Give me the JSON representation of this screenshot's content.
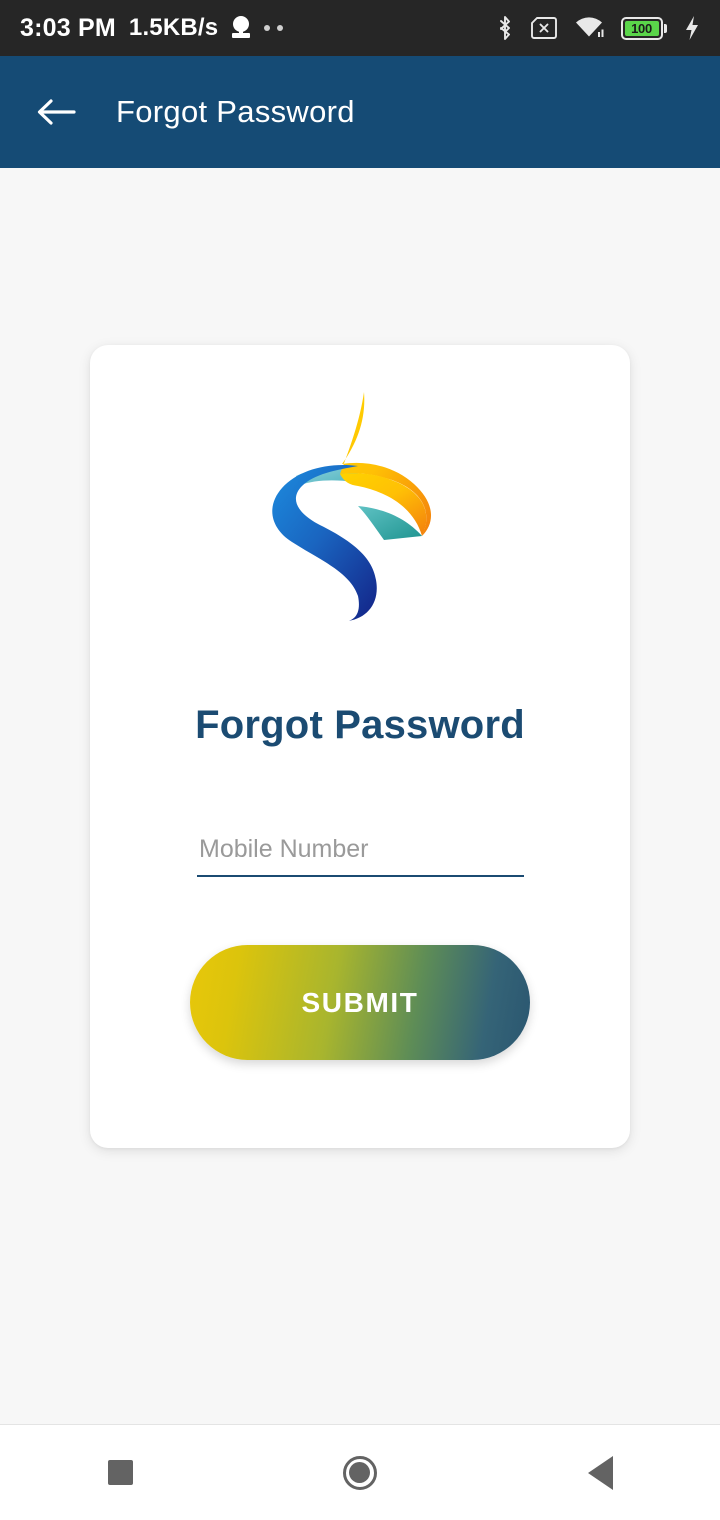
{
  "status_bar": {
    "time": "3:03 PM",
    "network_speed": "1.5KB/s",
    "battery_percent": "100",
    "icons": {
      "mic": "microphone-icon",
      "dots": "more-dots-icon",
      "bluetooth": "bluetooth-icon",
      "sd_card": "sd-card-error-icon",
      "wifi": "wifi-icon",
      "battery": "battery-icon",
      "charging": "charging-bolt-icon"
    },
    "colors": {
      "background": "#262626",
      "battery_fill": "#5ad54a",
      "text": "#ffffff"
    }
  },
  "app_bar": {
    "back_icon": "back-arrow-icon",
    "title": "Forgot Password",
    "color": "#154B75"
  },
  "card": {
    "logo": {
      "name": "company-logo",
      "colors": {
        "yellow": "#FFC805",
        "orange": "#F58B0A",
        "teal": "#2FA5A0",
        "light_teal": "#6FC6D0",
        "blue_light": "#1E7FD4",
        "blue_dark": "#152D90"
      }
    },
    "title": "Forgot Password",
    "title_color": "#1B4B72",
    "mobile_field": {
      "placeholder": "Mobile Number",
      "value": "",
      "underline_color": "#1B4B72"
    },
    "submit_button": {
      "label": "SUBMIT",
      "gradient_start": "#E8C70A",
      "gradient_end": "#2A5670",
      "text_color": "#ffffff"
    },
    "background": "#ffffff"
  },
  "page": {
    "background": "#f7f7f7"
  },
  "nav_bar": {
    "recents": "recents-square-icon",
    "home": "home-circle-icon",
    "back": "back-triangle-icon",
    "color": "#636363"
  }
}
